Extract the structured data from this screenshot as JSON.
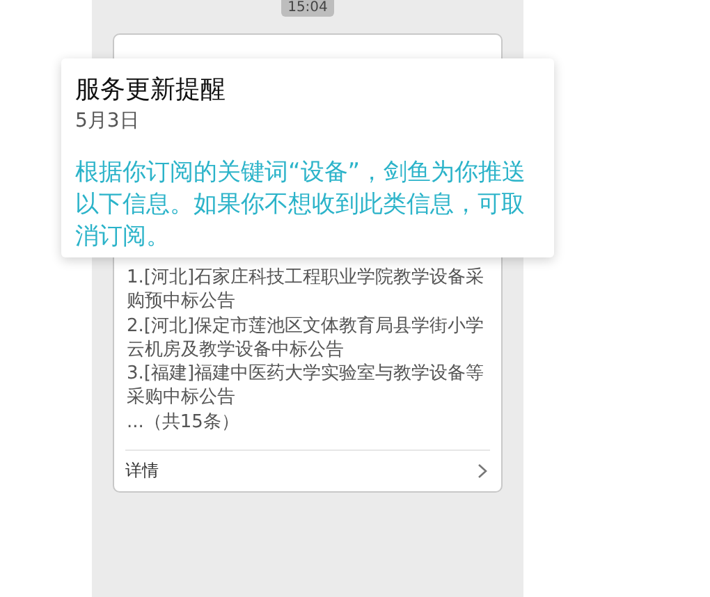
{
  "timestamp": "15:04",
  "notice": {
    "title": "服务更新提醒",
    "date": "5月3日",
    "body": "根据你订阅的关键词“设备”，剑鱼为你推送以下信息。如果你不想收到此类信息，可取消订阅。"
  },
  "card": {
    "items": [
      "1.[河北]石家庄科技工程职业学院教学设备采购预中标公告",
      "2.[河北]保定市莲池区文体教育局县学街小学云机房及教学设备中标公告",
      "3.[福建]福建中医药大学实验室与教学设备等采购中标公告",
      "...（共15条）"
    ],
    "details_link": "详情"
  }
}
